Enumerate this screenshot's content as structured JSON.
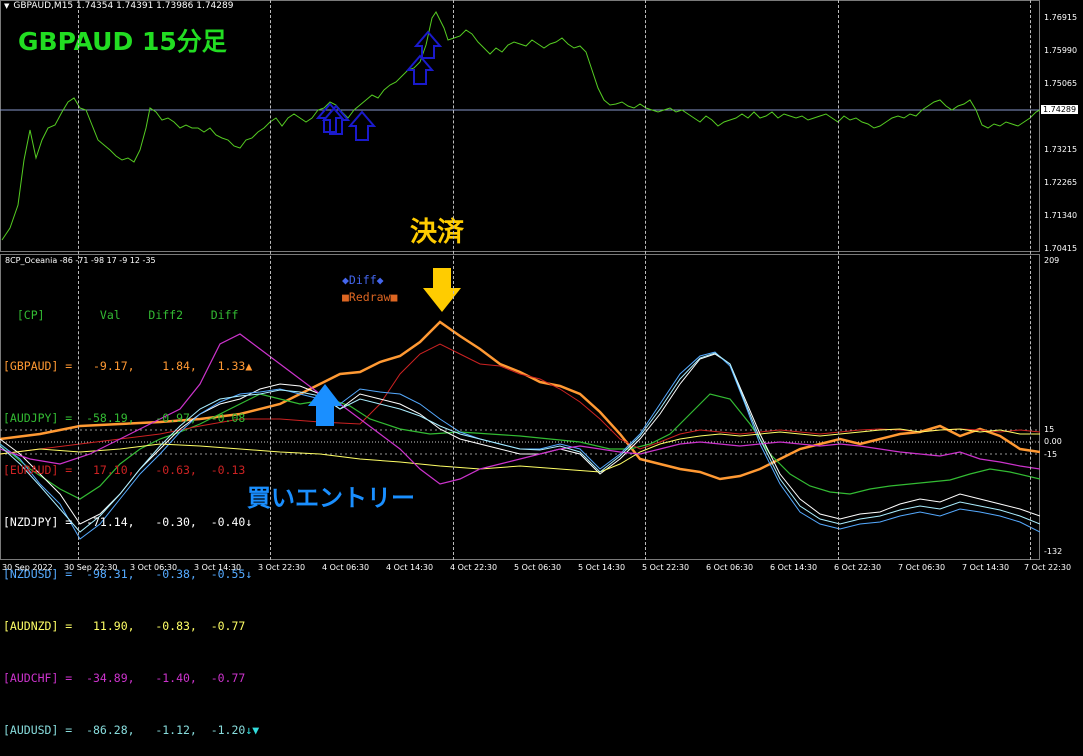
{
  "window": {
    "symbol_info": "GBPAUD,M15  1.74354 1.74391 1.73986 1.74289",
    "annotation": "GBPAUD 15分足"
  },
  "price_axis": {
    "ticks": [
      "1.76915",
      "1.75990",
      "1.75065",
      "1.73215",
      "1.72265",
      "1.71340",
      "1.70415"
    ],
    "current_price": "1.74289"
  },
  "indicator": {
    "title": "8CP_Oceania -86 -71 -98 17 -9 12 -35",
    "axis_ticks": [
      "209",
      "15",
      "0.00",
      "-15",
      "-132"
    ],
    "header": "  [CP]        Val    Diff2    Diff",
    "rows": [
      {
        "text": "[GBPAUD] =   -9.17,    1.84,   1.33",
        "color": "#ff9933",
        "mark": "▲",
        "mark_color": "#ff9933"
      },
      {
        "text": "[AUDJPY] =  -58.19,   -0.97,  -0.08",
        "color": "#33bb33",
        "mark": "",
        "mark_color": ""
      },
      {
        "text": "[EURAUD] =   17.10,   -0.63,  -0.13",
        "color": "#cc2222",
        "mark": "",
        "mark_color": ""
      },
      {
        "text": "[NZDJPY] =  -71.14,   -0.30,  -0.40",
        "color": "#ffffff",
        "mark": "↓",
        "mark_color": "#ffffff"
      },
      {
        "text": "[NZDUSD] =  -98.31,   -0.38,  -0.55",
        "color": "#55aaff",
        "mark": "↓",
        "mark_color": "#55aaff"
      },
      {
        "text": "[AUDNZD] =   11.90,   -0.83,  -0.77",
        "color": "#ffff66",
        "mark": "",
        "mark_color": ""
      },
      {
        "text": "[AUDCHF] =  -34.89,   -1.40,  -0.77",
        "color": "#cc33cc",
        "mark": "",
        "mark_color": ""
      },
      {
        "text": "[AUDUSD] =  -86.28,   -1.12,  -1.20",
        "color": "#88dddd",
        "mark": "↓▼",
        "mark_color": "#33dddd"
      }
    ],
    "diff_label": "◆Diff◆",
    "redraw_label": "■Redraw■"
  },
  "annotations": {
    "settle": "決済",
    "buy_entry": "買いエントリー"
  },
  "time_axis": [
    "30 Sep 2022",
    "30 Sep 22:30",
    "3 Oct 06:30",
    "3 Oct 14:30",
    "3 Oct 22:30",
    "4 Oct 06:30",
    "4 Oct 14:30",
    "4 Oct 22:30",
    "5 Oct 06:30",
    "5 Oct 14:30",
    "5 Oct 22:30",
    "6 Oct 06:30",
    "6 Oct 14:30",
    "6 Oct 22:30",
    "7 Oct 06:30",
    "7 Oct 14:30",
    "7 Oct 22:30"
  ],
  "colors": {
    "price_line": "#55cc22",
    "annotation_green": "#22dd22",
    "settle_yellow": "#ffcc00",
    "entry_blue": "#1a8fff",
    "arrow_navy": "#1a1acc"
  }
}
